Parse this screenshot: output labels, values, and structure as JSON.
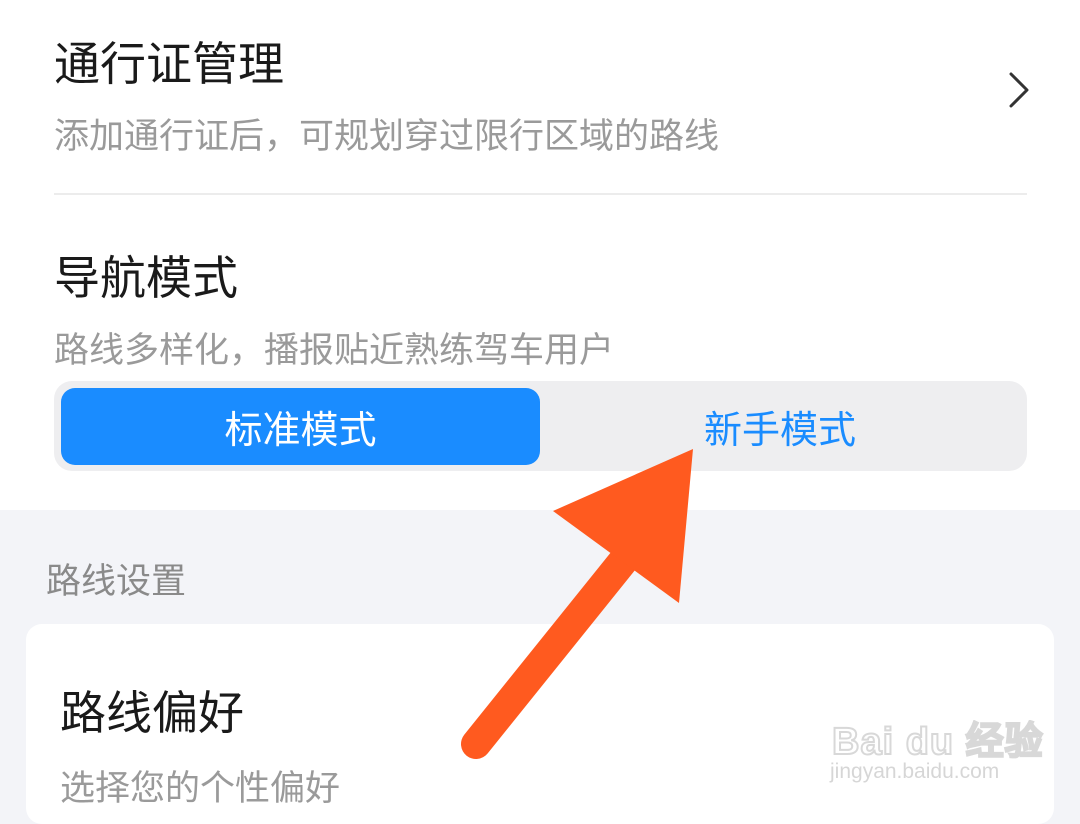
{
  "permit": {
    "title": "通行证管理",
    "subtitle": "添加通行证后，可规划穿过限行区域的路线",
    "chevron_icon": "chevron-right-icon"
  },
  "nav_mode": {
    "title": "导航模式",
    "subtitle": "路线多样化，播报贴近熟练驾车用户",
    "options": [
      {
        "label": "标准模式",
        "selected": true
      },
      {
        "label": "新手模式",
        "selected": false
      }
    ],
    "accent_color": "#1a8cff"
  },
  "route_settings": {
    "section_label": "路线设置",
    "preference": {
      "title": "路线偏好",
      "subtitle": "选择您的个性偏好"
    }
  },
  "annotation": {
    "arrow_color": "#ff5a1f",
    "arrow_icon": "arrow-annotation-icon"
  },
  "watermark": {
    "logo_text": "Bai du 经验",
    "url": "jingyan.baidu.com"
  }
}
